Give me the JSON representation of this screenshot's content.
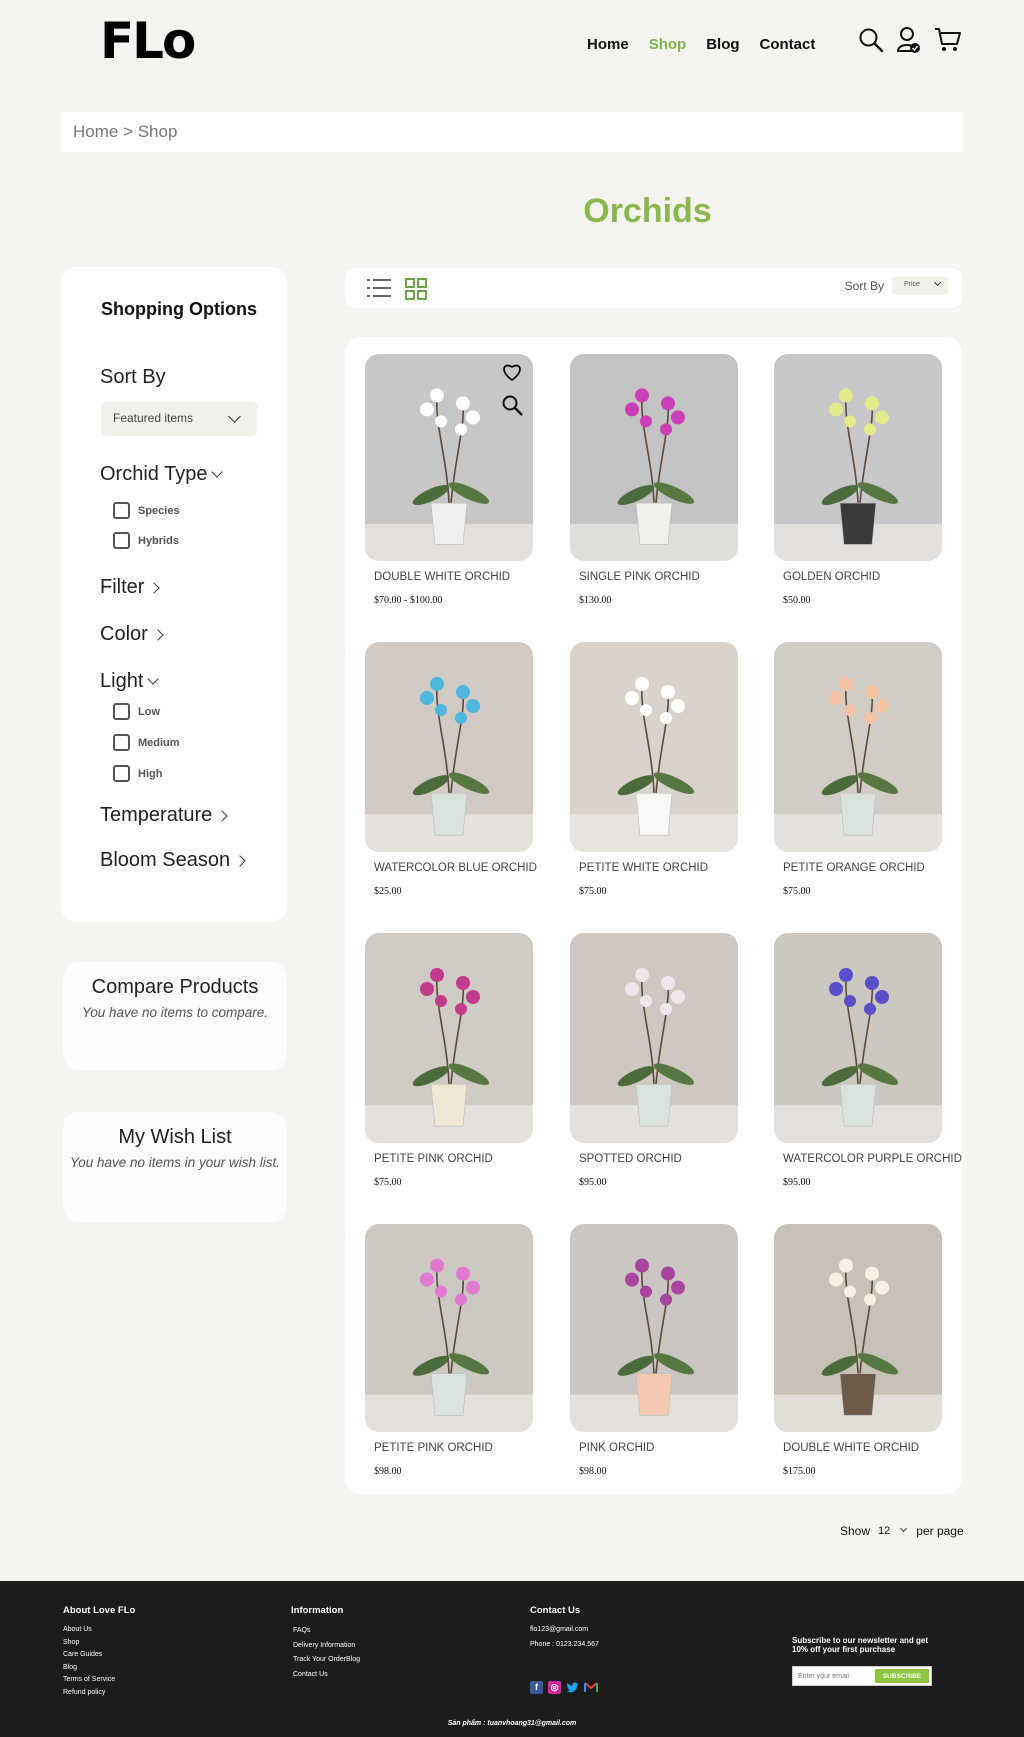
{
  "header": {
    "logo": "FLo",
    "nav": [
      {
        "label": "Home",
        "active": false
      },
      {
        "label": "Shop",
        "active": true
      },
      {
        "label": "Blog",
        "active": false
      },
      {
        "label": "Contact",
        "active": false
      }
    ],
    "icons": [
      "search-icon",
      "account-icon",
      "cart-icon"
    ]
  },
  "breadcrumb": "Home > Shop",
  "page_title": "Orchids",
  "sidebar": {
    "title": "Shopping Options",
    "sort_by_label": "Sort By",
    "sort_by_value": "Featured items",
    "orchid_type": {
      "label": "Orchid Type",
      "options": [
        "Species",
        "Hybrids"
      ]
    },
    "filter_label": "Filter",
    "color_label": "Color",
    "light": {
      "label": "Light",
      "options": [
        "Low",
        "Medium",
        "High"
      ]
    },
    "temperature_label": "Temperature",
    "bloom_season_label": "Bloom Season"
  },
  "compare": {
    "title": "Compare Products",
    "text": "You have no items to compare."
  },
  "wishlist": {
    "title": "My Wish List",
    "text": "You have no items in your wish list."
  },
  "toolbar": {
    "sort_label": "Sort By",
    "sort_value": "Price"
  },
  "products": [
    {
      "name": "DOUBLE WHITE ORCHID",
      "price": "$70.00 - $100.00",
      "flower": "#ffffff",
      "pot": "#efefef",
      "bg": "#c9c7c6"
    },
    {
      "name": "SINGLE PINK ORCHID",
      "price": "$130.00",
      "flower": "#c93fb5",
      "pot": "#f2f0ec",
      "bg": "#c4c3c3"
    },
    {
      "name": "GOLDEN ORCHID",
      "price": "$50.00",
      "flower": "#e3ea8a",
      "pot": "#3a3a3a",
      "bg": "#c8c7c9"
    },
    {
      "name": "WATERCOLOR BLUE ORCHID",
      "price": "$25.00",
      "flower": "#4fb6e0",
      "pot": "#d9e2dc",
      "bg": "#d2cbc5"
    },
    {
      "name": "PETITE WHITE ORCHID",
      "price": "$75.00",
      "flower": "#ffffff",
      "pot": "#f7f7f5",
      "bg": "#dad3cc"
    },
    {
      "name": "PETITE ORANGE ORCHID",
      "price": "$75.00",
      "flower": "#f3c3a4",
      "pot": "#d9e2dc",
      "bg": "#d2ccc6"
    },
    {
      "name": "PETITE PINK ORCHID",
      "price": "$75.00",
      "flower": "#c23b8c",
      "pot": "#f0e7d4",
      "bg": "#d1cbc5"
    },
    {
      "name": "SPOTTED ORCHID",
      "price": "$95.00",
      "flower": "#f2e6ec",
      "pot": "#d9e2dc",
      "bg": "#cfc8c2"
    },
    {
      "name": "WATERCOLOR PURPLE ORCHID",
      "price": "$95.00",
      "flower": "#5b4fc9",
      "pot": "#d9e2dc",
      "bg": "#cdc7c1"
    },
    {
      "name": "PETITE PINK ORCHID",
      "price": "$98.00",
      "flower": "#e07ad0",
      "pot": "#d9e2dc",
      "bg": "#cec8c2"
    },
    {
      "name": "PINK ORCHID",
      "price": "$98.00",
      "flower": "#a8459e",
      "pot": "#f3c9b0",
      "bg": "#cbc6c3"
    },
    {
      "name": "DOUBLE WHITE ORCHID",
      "price": "$175.00",
      "flower": "#f7f1e4",
      "pot": "#6e5a48",
      "bg": "#c8c2b6"
    }
  ],
  "pagination": {
    "show_label": "Show",
    "value": "12",
    "per_page_label": "per page"
  },
  "footer": {
    "about": {
      "title": "About Love FLo",
      "links": [
        "About Us",
        "Shop",
        "Care Guides",
        "Blog",
        "Terms of Service",
        "Refund policy"
      ]
    },
    "information": {
      "title": "Information",
      "links": [
        "FAQs",
        "Delivery Information",
        "Track Your OrderBlog",
        "Contact Us"
      ]
    },
    "contact": {
      "title": "Contact Us",
      "email": "flo123@gmail.com",
      "phone": "Phone : 0123.234.567"
    },
    "newsletter": {
      "text": "Subscribe to our newsletter and get 10% off your first purchase",
      "placeholder": "Enter your email",
      "button": "SUBSCRIBE"
    },
    "credit": "Sản phẩm : tuanvhoang31@gmail.com"
  },
  "colors": {
    "accent": "#8ab84f",
    "nav_active": "#7ab648",
    "footer_bg": "#1c1c1c"
  }
}
